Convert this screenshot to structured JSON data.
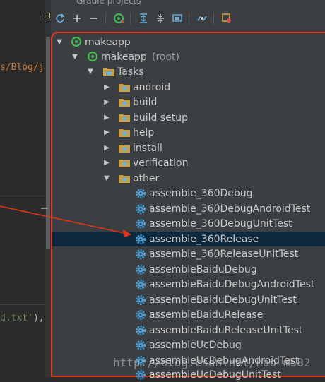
{
  "editor": {
    "code_top": "s/Blog/jk",
    "code_bottom_str": "d.txt'",
    "code_bottom_punct": "),"
  },
  "panel": {
    "title": "Gradle projects"
  },
  "toolbar": {
    "buttons": [
      "refresh-icon",
      "plus-icon",
      "minus-icon",
      "gradle-run-icon",
      "expand-all-icon",
      "collapse-all-icon",
      "toggle-offline-icon",
      "link-icon",
      "settings-icon"
    ]
  },
  "tree": {
    "root": "makeapp",
    "project": "makeapp",
    "project_suffix": "(root)",
    "tasks": "Tasks",
    "groups": [
      "android",
      "build",
      "build setup",
      "help",
      "install",
      "verification",
      "other"
    ],
    "other_tasks": [
      "assemble_360Debug",
      "assemble_360DebugAndroidTest",
      "assemble_360DebugUnitTest",
      "assemble_360Release",
      "assemble_360ReleaseUnitTest",
      "assembleBaiduDebug",
      "assembleBaiduDebugAndroidTest",
      "assembleBaiduDebugUnitTest",
      "assembleBaiduRelease",
      "assembleBaiduReleaseUnitTest",
      "assembleUcDebug",
      "assembleUcDebugAndroidTest",
      "assembleUcDebugUnitTest"
    ],
    "selected": "assemble_360Release"
  },
  "watermark": "http://blog.csdn.net/hao_m582",
  "colors": {
    "highlight_border": "#e0331e",
    "selection": "#0d293e",
    "gradle_green": "#3fb950",
    "gear_blue": "#4a9fd8",
    "folder": "#c9a04a"
  }
}
